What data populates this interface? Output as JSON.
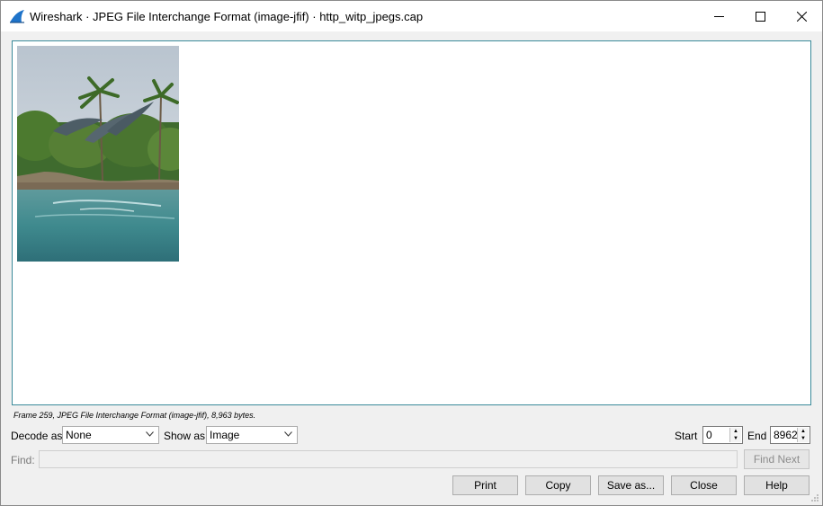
{
  "window": {
    "title": "Wireshark · JPEG File Interchange Format (image-jfif) · http_witp_jpegs.cap",
    "minimize_icon": "minimize-icon",
    "maximize_icon": "maximize-icon",
    "close_icon": "close-icon",
    "accent": "#1e73c9"
  },
  "status_text": "Frame 259, JPEG File Interchange Format (image-jfif), 8,963 bytes.",
  "controls": {
    "decode_as_label": "Decode as",
    "decode_as_value": "None",
    "show_as_label": "Show as",
    "show_as_value": "Image",
    "start_label": "Start",
    "start_value": "0",
    "end_label": "End",
    "end_value": "8962"
  },
  "find": {
    "label": "Find:",
    "value": "",
    "next_label": "Find Next"
  },
  "buttons": {
    "print": "Print",
    "copy": "Copy",
    "save_as": "Save as...",
    "close": "Close",
    "help": "Help"
  }
}
